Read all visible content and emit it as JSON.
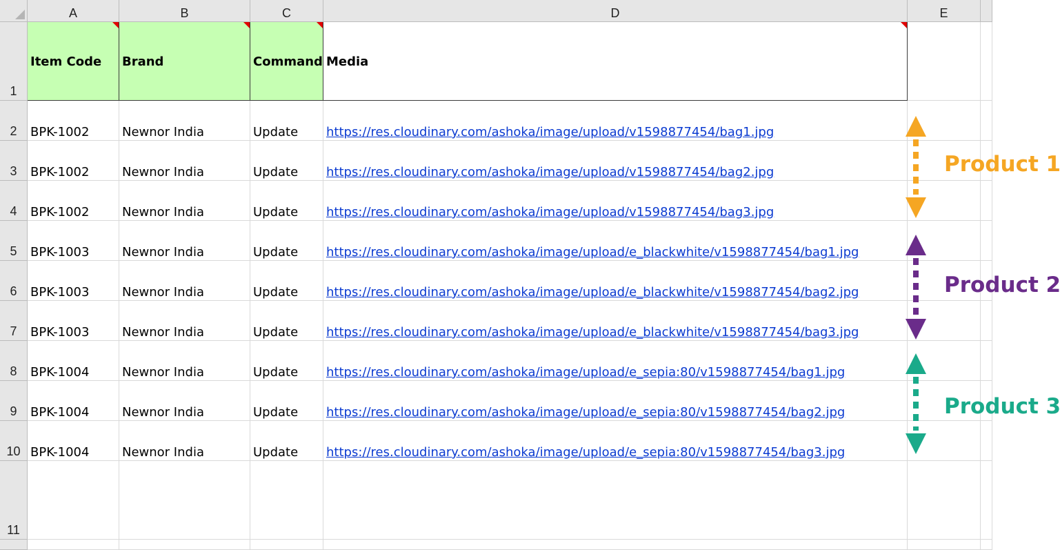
{
  "columns": [
    "A",
    "B",
    "C",
    "D",
    "E"
  ],
  "rows": [
    "1",
    "2",
    "3",
    "4",
    "5",
    "6",
    "7",
    "8",
    "9",
    "10",
    "11"
  ],
  "header": {
    "item_code": "Item Code",
    "brand": "Brand",
    "command": "Command",
    "media": "Media"
  },
  "data": [
    {
      "item_code": "BPK-1002",
      "brand": "Newnor India",
      "command": "Update",
      "media": "https://res.cloudinary.com/ashoka/image/upload/v1598877454/bag1.jpg"
    },
    {
      "item_code": "BPK-1002",
      "brand": "Newnor India",
      "command": "Update",
      "media": "https://res.cloudinary.com/ashoka/image/upload/v1598877454/bag2.jpg"
    },
    {
      "item_code": "BPK-1002",
      "brand": "Newnor India",
      "command": "Update",
      "media": "https://res.cloudinary.com/ashoka/image/upload/v1598877454/bag3.jpg"
    },
    {
      "item_code": "BPK-1003",
      "brand": "Newnor India",
      "command": "Update",
      "media": "https://res.cloudinary.com/ashoka/image/upload/e_blackwhite/v1598877454/bag1.jpg"
    },
    {
      "item_code": "BPK-1003",
      "brand": "Newnor India",
      "command": "Update",
      "media": "https://res.cloudinary.com/ashoka/image/upload/e_blackwhite/v1598877454/bag2.jpg"
    },
    {
      "item_code": "BPK-1003",
      "brand": "Newnor India",
      "command": "Update",
      "media": "https://res.cloudinary.com/ashoka/image/upload/e_blackwhite/v1598877454/bag3.jpg"
    },
    {
      "item_code": "BPK-1004",
      "brand": "Newnor India",
      "command": "Update",
      "media": "https://res.cloudinary.com/ashoka/image/upload/e_sepia:80/v1598877454/bag1.jpg"
    },
    {
      "item_code": "BPK-1004",
      "brand": "Newnor India",
      "command": "Update",
      "media": "https://res.cloudinary.com/ashoka/image/upload/e_sepia:80/v1598877454/bag2.jpg"
    },
    {
      "item_code": "BPK-1004",
      "brand": "Newnor India",
      "command": "Update",
      "media": "https://res.cloudinary.com/ashoka/image/upload/e_sepia:80/v1598877454/bag3.jpg"
    }
  ],
  "annotations": [
    {
      "label": "Product 1",
      "color": "#f5a623"
    },
    {
      "label": "Product 2",
      "color": "#6a2c8a"
    },
    {
      "label": "Product 3",
      "color": "#1aaa8a"
    }
  ],
  "colors": {
    "header_fill": "#c6ffb3",
    "link": "#0b3bd1",
    "comment_marker": "#e00000"
  }
}
